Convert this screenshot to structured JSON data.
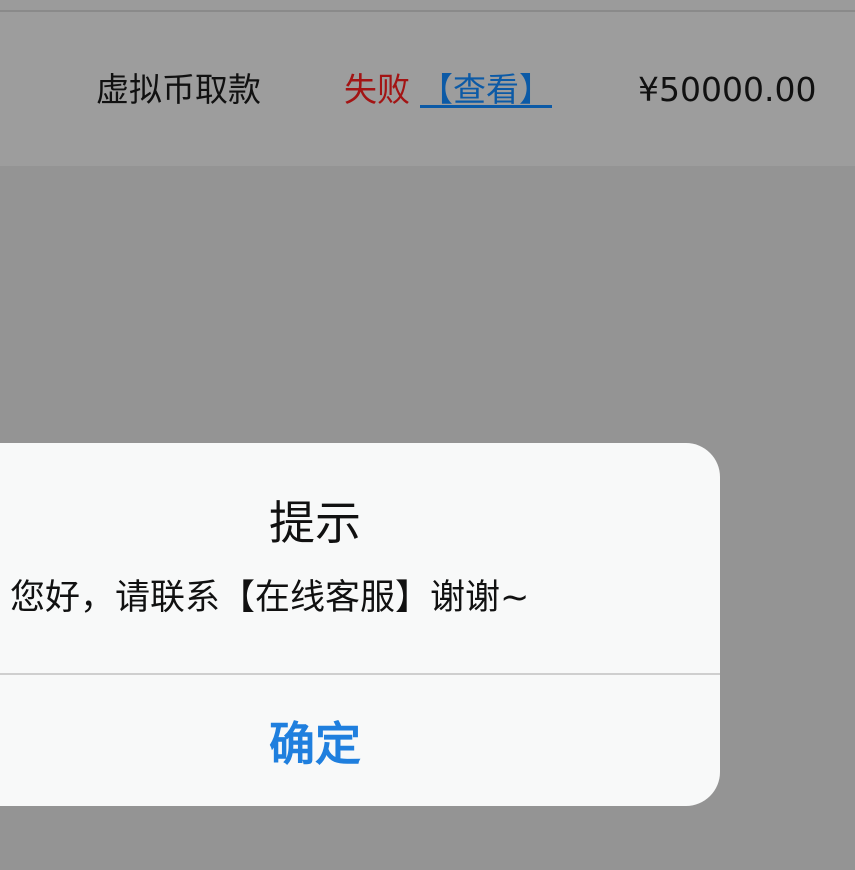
{
  "record": {
    "type": "虚拟币取款",
    "status": "失败",
    "view_link": "【查看】",
    "amount": "¥50000.00"
  },
  "dialog": {
    "title": "提示",
    "message": "您好，请联系【在线客服】谢谢~",
    "confirm_label": "确定"
  },
  "colors": {
    "status_failed": "#a31414",
    "link": "#0c5aa6",
    "confirm": "#1f7fde"
  }
}
